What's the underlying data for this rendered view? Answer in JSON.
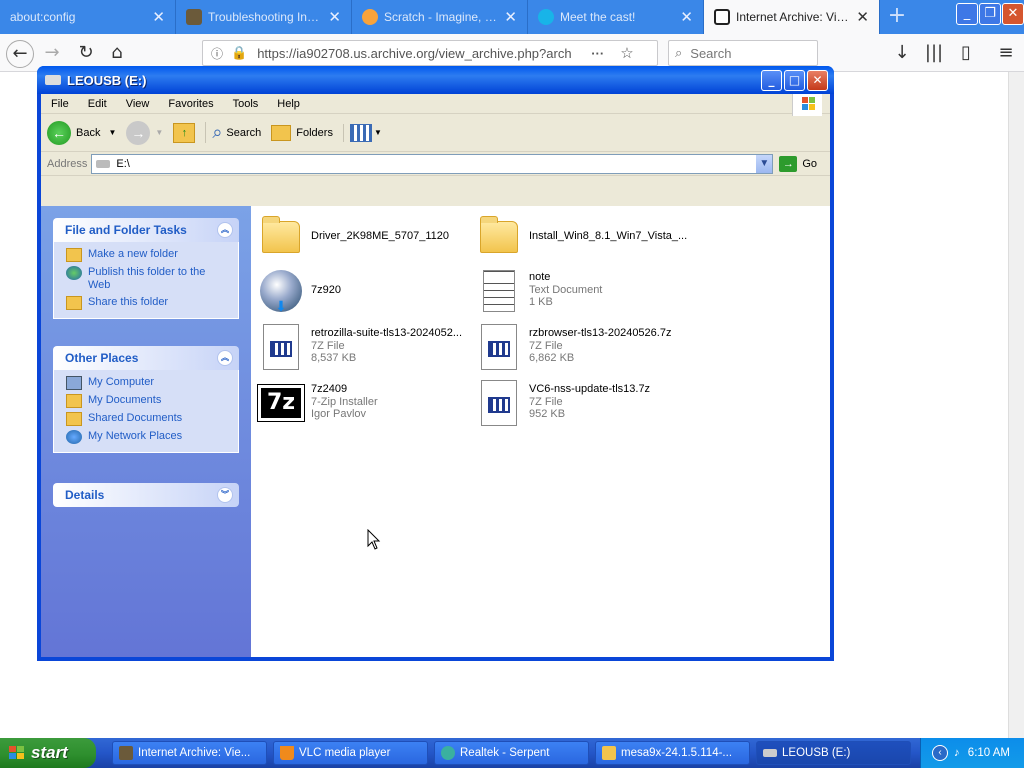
{
  "browser": {
    "tabs": [
      {
        "title": "about:config",
        "active": false
      },
      {
        "title": "Troubleshooting Infone...",
        "active": false
      },
      {
        "title": "Scratch - Imagine, Prog...",
        "active": false
      },
      {
        "title": "Meet the cast!",
        "active": false
      },
      {
        "title": "Internet Archive: View A",
        "active": true
      }
    ],
    "url": "https://ia902708.us.archive.org/view_archive.php?arch",
    "search_placeholder": "Search"
  },
  "explorer": {
    "title": "LEOUSB (E:)",
    "menu": [
      "File",
      "Edit",
      "View",
      "Favorites",
      "Tools",
      "Help"
    ],
    "toolbar": {
      "back": "Back",
      "search": "Search",
      "folders": "Folders"
    },
    "address_label": "Address",
    "address_value": "E:\\",
    "go_label": "Go",
    "tasks": {
      "file_folder": {
        "title": "File and Folder Tasks",
        "items": [
          "Make a new folder",
          "Publish this folder to the Web",
          "Share this folder"
        ]
      },
      "other_places": {
        "title": "Other Places",
        "items": [
          "My Computer",
          "My Documents",
          "Shared Documents",
          "My Network Places"
        ]
      },
      "details": {
        "title": "Details"
      }
    },
    "files": [
      {
        "name": "Driver_2K98ME_5707_1120",
        "type": "",
        "size": "",
        "icon": "folder-icon"
      },
      {
        "name": "Install_Win8_8.1_Win7_Vista_...",
        "type": "",
        "size": "",
        "icon": "folder-icon"
      },
      {
        "name": "7z920",
        "type": "",
        "size": "",
        "icon": "nsis-installer-icon"
      },
      {
        "name": "note",
        "type": "Text Document",
        "size": "1 KB",
        "icon": "text-document-icon"
      },
      {
        "name": "retrozilla-suite-tls13-2024052...",
        "type": "7Z File",
        "size": "8,537 KB",
        "icon": "7z-file-icon"
      },
      {
        "name": "rzbrowser-tls13-20240526.7z",
        "type": "7Z File",
        "size": "6,862 KB",
        "icon": "7z-file-icon"
      },
      {
        "name": "7z2409",
        "type": "7-Zip Installer",
        "size": "Igor Pavlov",
        "icon": "7zip-installer-icon"
      },
      {
        "name": "VC6-nss-update-tls13.7z",
        "type": "7Z File",
        "size": "952 KB",
        "icon": "7z-file-icon"
      }
    ]
  },
  "taskbar": {
    "start_label": "start",
    "items": [
      {
        "label": "Internet Archive: Vie...",
        "active": false
      },
      {
        "label": "VLC media player",
        "active": false
      },
      {
        "label": "Realtek - Serpent",
        "active": false
      },
      {
        "label": "mesa9x-24.1.5.114-...",
        "active": false
      },
      {
        "label": "LEOUSB (E:)",
        "active": true
      }
    ],
    "clock": "6:10 AM"
  },
  "colors": {
    "xp_blue": "#0a46d8",
    "tab_bar": "#3a87e8",
    "task_panel": "#d6dff7"
  }
}
